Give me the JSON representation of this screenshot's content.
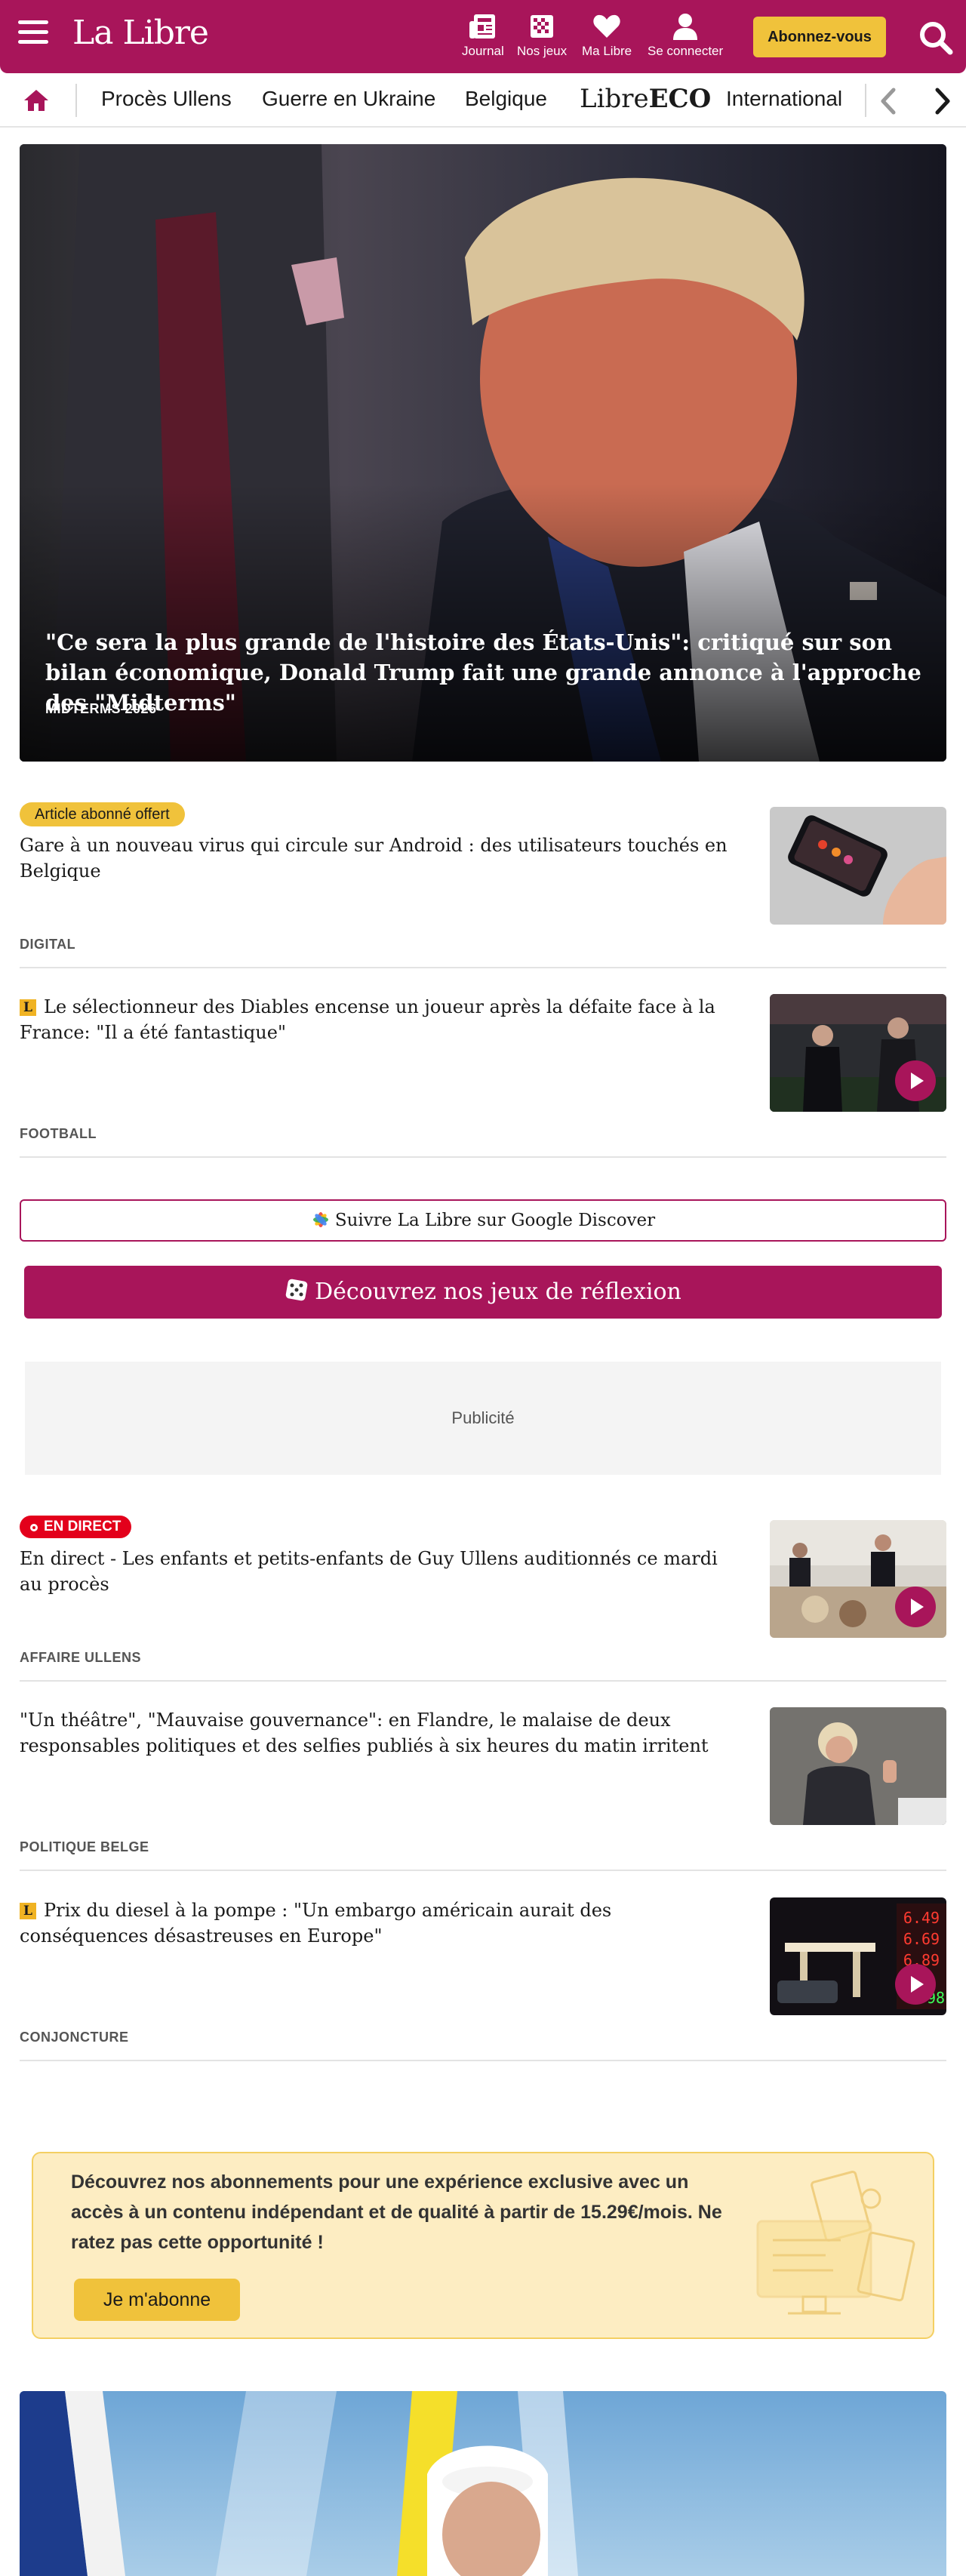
{
  "header": {
    "logo": "La Libre",
    "actions": [
      {
        "label": "Journal",
        "icon": "newspaper-icon"
      },
      {
        "label": "Nos jeux",
        "icon": "games-grid-icon"
      },
      {
        "label": "Ma Libre",
        "icon": "heart-icon"
      },
      {
        "label": "Se connecter",
        "icon": "user-icon"
      }
    ],
    "subscribe_label": "Abonnez-vous",
    "brand_color": "#a8155a",
    "accent_color": "#f0c23b"
  },
  "nav": {
    "items": [
      "Procès Ullens",
      "Guerre en Ukraine",
      "Belgique",
      "International"
    ],
    "eco_prefix": "Libre",
    "eco_suffix": "ECO"
  },
  "hero": {
    "title": "\"Ce sera la plus grande de l'histoire des États-Unis\": critiqué sur son bilan économique, Donald Trump fait une grande annonce à l'approche des \"Midterms\"",
    "tag": "MIDTERMS 2026"
  },
  "articles": [
    {
      "badge": "Article abonné offert",
      "title": "Gare à un nouveau virus qui circule sur Android : des utilisateurs touchés en Belgique",
      "category": "DIGITAL",
      "premium": false,
      "video": false
    },
    {
      "badge": "",
      "title": "Le sélectionneur des Diables encense un joueur après la défaite face à la France: \"Il a été fantastique\"",
      "category": "FOOTBALL",
      "premium": true,
      "premium_mark": "L",
      "video": true
    },
    {
      "badge": "EN DIRECT",
      "title": "En direct - Les enfants et petits-enfants de Guy Ullens auditionnés ce mardi au procès",
      "category": "AFFAIRE ULLENS",
      "premium": false,
      "video": true
    },
    {
      "badge": "",
      "title": "\"Un théâtre\", \"Mauvaise gouvernance\": en Flandre, le malaise de deux responsables politiques et des selfies publiés à six heures du matin irritent",
      "category": "POLITIQUE BELGE",
      "premium": false,
      "video": false
    },
    {
      "badge": "",
      "title": "Prix du diesel à la pompe : \"Un embargo américain aurait des conséquences désastreuses en Europe\"",
      "category": "CONJONCTURE",
      "premium": true,
      "premium_mark": "L",
      "video": true
    }
  ],
  "fuel_prices": [
    "6.49",
    "6.69",
    "6.89",
    "98"
  ],
  "google_discover_label": "Suivre La Libre sur Google Discover",
  "games_label": "Découvrez nos jeux de réflexion",
  "ad_label": "Publicité",
  "promo": {
    "text": "Découvrez nos abonnements pour une expérience exclusive avec un accès à un contenu indépendant et de qualité à partir de 15.29€/mois. Ne ratez pas cette opportunité !",
    "button_label": "Je m'abonne"
  }
}
